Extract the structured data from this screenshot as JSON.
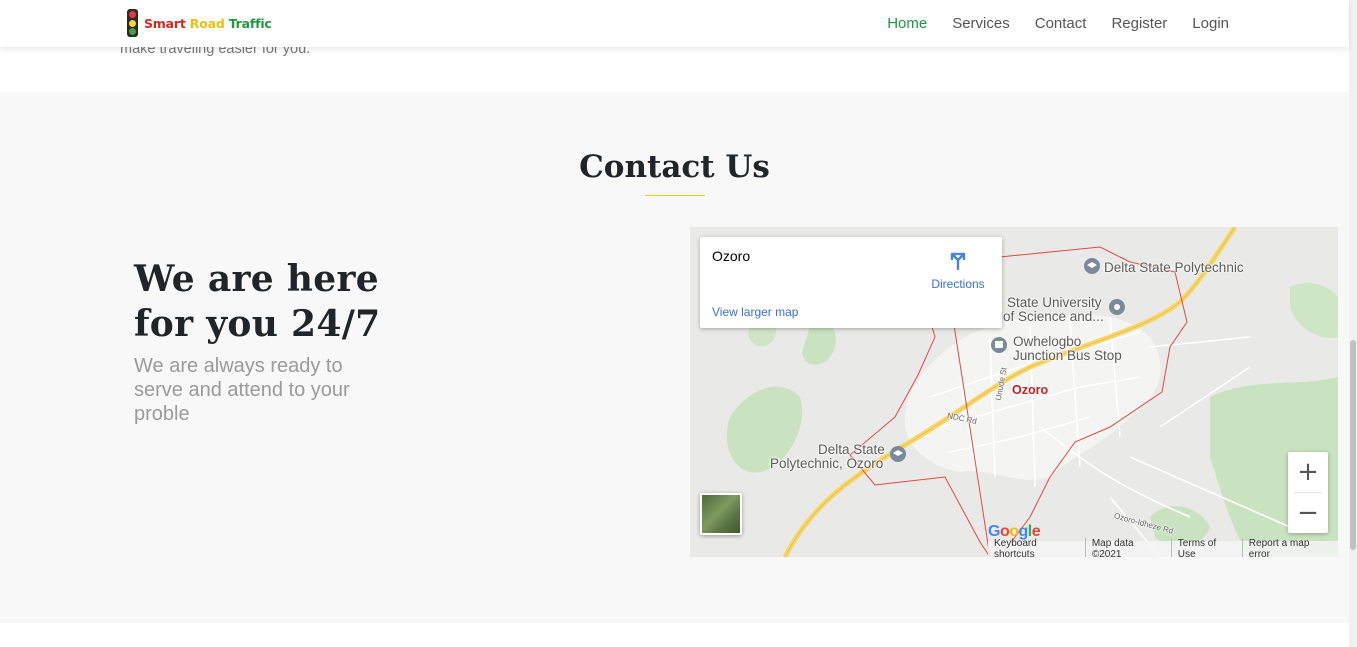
{
  "brand": {
    "word1": "Smart",
    "word2": "Road",
    "word3": "Traffic"
  },
  "nav": {
    "items": [
      {
        "label": "Home",
        "active": true
      },
      {
        "label": "Services"
      },
      {
        "label": "Contact"
      },
      {
        "label": "Register"
      },
      {
        "label": "Login"
      }
    ]
  },
  "peek_text": "make traveling easier for you.",
  "contact": {
    "title": "Contact Us",
    "headline": "We are here for you 24/7",
    "subtext": "We are always ready to serve and attend to your proble"
  },
  "map": {
    "infocard": {
      "place": "Ozoro",
      "directions": "Directions",
      "view_larger": "View larger map"
    },
    "labels": {
      "delta_poly": "Delta State Polytechnic",
      "state_univ_1": "State University",
      "state_univ_2": "of Science and...",
      "owhelogbo_1": "Owhelogbo",
      "owhelogbo_2": "Junction Bus Stop",
      "ozoro": "Ozoro",
      "poly_ozoro_1": "Delta State",
      "poly_ozoro_2": "Polytechnic, Ozoro",
      "ndc_rd": "NDC Rd",
      "unude_st": "Unude St",
      "ozoro_idheze": "Ozoro-Idheze Rd"
    },
    "zoom_in": "+",
    "zoom_out": "−",
    "google": "Google",
    "attribution": [
      "Keyboard shortcuts",
      "Map data ©2021",
      "Terms of Use",
      "Report a map error"
    ]
  },
  "colors": {
    "accent": "#1e9447",
    "underline": "#e2cf2a",
    "link": "#3a6fd4",
    "boundary": "#e04a3f"
  }
}
